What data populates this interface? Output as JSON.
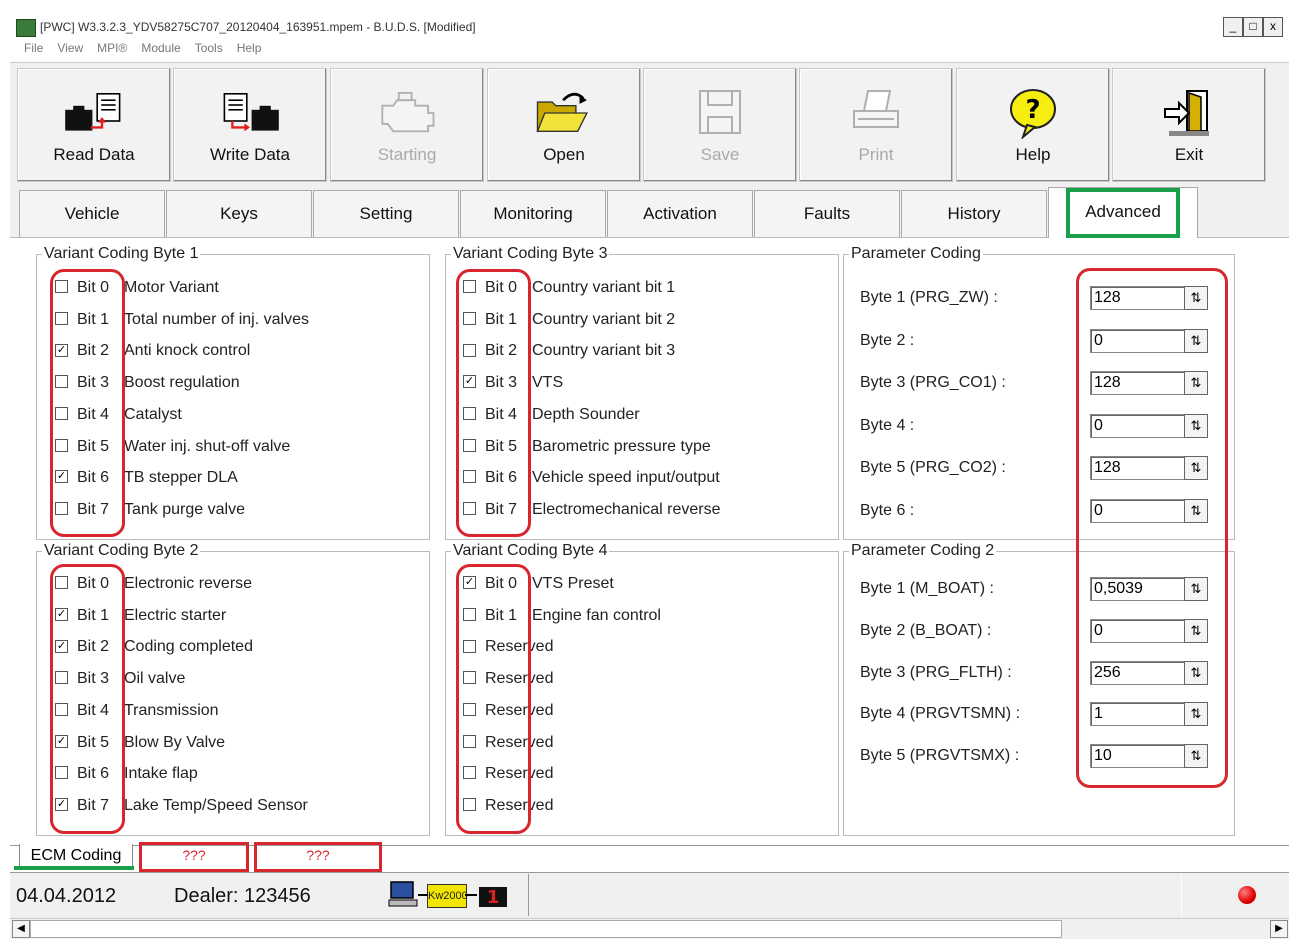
{
  "window": {
    "title": "[PWC] W3.3.2.3_YDV58275C707_20120404_163951.mpem - B.U.D.S. [Modified]",
    "controls": [
      "_",
      "□",
      "x"
    ]
  },
  "menu": [
    "File",
    "View",
    "MPI®",
    "Module",
    "Tools",
    "Help"
  ],
  "toolbar": [
    {
      "label": "Read Data",
      "icon": "read-data-icon"
    },
    {
      "label": "Write Data",
      "icon": "write-data-icon"
    },
    {
      "label": "Starting",
      "icon": "engine-icon"
    },
    {
      "label": "Open",
      "icon": "folder-open-icon"
    },
    {
      "label": "Save",
      "icon": "floppy-icon"
    },
    {
      "label": "Print",
      "icon": "printer-icon"
    },
    {
      "label": "Help",
      "icon": "help-icon"
    },
    {
      "label": "Exit",
      "icon": "exit-icon"
    }
  ],
  "tabs": [
    "Vehicle",
    "Keys",
    "Setting",
    "Monitoring",
    "Activation",
    "Faults",
    "History",
    "Advanced"
  ],
  "vcb1": {
    "title": "Variant Coding Byte 1",
    "items": [
      {
        "bit": "Bit 0",
        "label": "Motor Variant",
        "checked": false
      },
      {
        "bit": "Bit 1",
        "label": "Total number of inj. valves",
        "checked": false
      },
      {
        "bit": "Bit 2",
        "label": "Anti knock control",
        "checked": true
      },
      {
        "bit": "Bit 3",
        "label": "Boost regulation",
        "checked": false
      },
      {
        "bit": "Bit 4",
        "label": "Catalyst",
        "checked": false
      },
      {
        "bit": "Bit 5",
        "label": "Water inj. shut-off valve",
        "checked": false
      },
      {
        "bit": "Bit 6",
        "label": "TB stepper DLA",
        "checked": true
      },
      {
        "bit": "Bit 7",
        "label": "Tank purge valve",
        "checked": false
      }
    ]
  },
  "vcb3": {
    "title": "Variant Coding Byte 3",
    "items": [
      {
        "bit": "Bit 0",
        "label": "Country variant bit 1",
        "checked": false
      },
      {
        "bit": "Bit 1",
        "label": "Country variant bit 2",
        "checked": false
      },
      {
        "bit": "Bit 2",
        "label": "Country variant bit 3",
        "checked": false
      },
      {
        "bit": "Bit 3",
        "label": "VTS",
        "checked": true
      },
      {
        "bit": "Bit 4",
        "label": "Depth Sounder",
        "checked": false
      },
      {
        "bit": "Bit 5",
        "label": "Barometric pressure type",
        "checked": false
      },
      {
        "bit": "Bit 6",
        "label": "Vehicle speed input/output",
        "checked": false
      },
      {
        "bit": "Bit 7",
        "label": "Electromechanical reverse",
        "checked": false
      }
    ]
  },
  "vcb2": {
    "title": "Variant Coding Byte 2",
    "items": [
      {
        "bit": "Bit 0",
        "label": "Electronic reverse",
        "checked": false
      },
      {
        "bit": "Bit 1",
        "label": "Electric starter",
        "checked": true
      },
      {
        "bit": "Bit 2",
        "label": "Coding completed",
        "checked": true
      },
      {
        "bit": "Bit 3",
        "label": "Oil valve",
        "checked": false
      },
      {
        "bit": "Bit 4",
        "label": "Transmission",
        "checked": false
      },
      {
        "bit": "Bit 5",
        "label": "Blow By Valve",
        "checked": true
      },
      {
        "bit": "Bit 6",
        "label": "Intake flap",
        "checked": false
      },
      {
        "bit": "Bit 7",
        "label": "Lake Temp/Speed Sensor",
        "checked": true
      }
    ]
  },
  "vcb4": {
    "title": "Variant Coding Byte 4",
    "items": [
      {
        "bit": "Bit 0",
        "label": "VTS Preset",
        "checked": true
      },
      {
        "bit": "Bit 1",
        "label": "Engine fan control",
        "checked": false
      },
      {
        "bit": "",
        "label": "Reserved",
        "checked": false
      },
      {
        "bit": "",
        "label": "Reserved",
        "checked": false
      },
      {
        "bit": "",
        "label": "Reserved",
        "checked": false
      },
      {
        "bit": "",
        "label": "Reserved",
        "checked": false
      },
      {
        "bit": "",
        "label": "Reserved",
        "checked": false
      },
      {
        "bit": "",
        "label": "Reserved",
        "checked": false
      }
    ]
  },
  "param1": {
    "title": "Parameter Coding",
    "items": [
      {
        "label": "Byte 1 (PRG_ZW) :",
        "value": "128"
      },
      {
        "label": "Byte 2 :",
        "value": "0"
      },
      {
        "label": "Byte 3 (PRG_CO1) :",
        "value": "128"
      },
      {
        "label": "Byte 4 :",
        "value": "0"
      },
      {
        "label": "Byte 5 (PRG_CO2) :",
        "value": "128"
      },
      {
        "label": "Byte 6 :",
        "value": "0"
      }
    ]
  },
  "param2": {
    "title": "Parameter Coding 2",
    "items": [
      {
        "label": "Byte 1 (M_BOAT) :",
        "value": "0,5039"
      },
      {
        "label": "Byte 2 (B_BOAT) :",
        "value": "0"
      },
      {
        "label": "Byte 3 (PRG_FLTH) :",
        "value": "256"
      },
      {
        "label": "Byte 4 (PRGVTSMN) :",
        "value": "1"
      },
      {
        "label": "Byte 5 (PRGVTSMX) :",
        "value": "10"
      }
    ]
  },
  "bottom_tabs": [
    "ECM Coding",
    "???",
    "???"
  ],
  "status": {
    "date": "04.04.2012",
    "dealer": "Dealer: 123456",
    "protocol": "Kw2000"
  },
  "colors": {
    "annotation_red": "#d8262e",
    "annotation_green": "#19a04a"
  }
}
